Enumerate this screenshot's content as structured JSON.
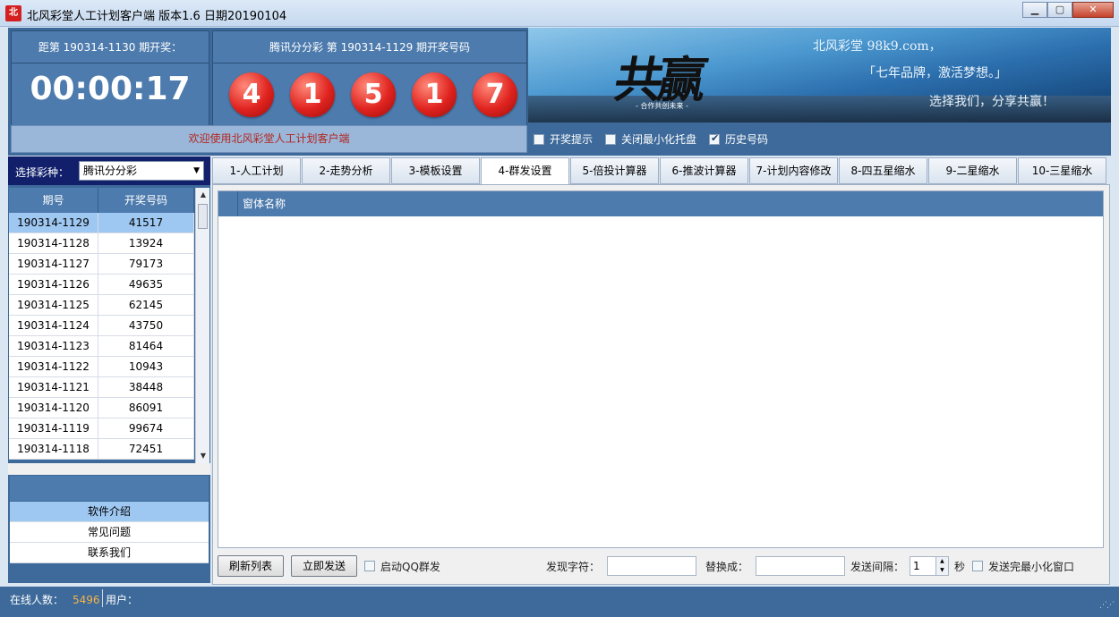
{
  "window": {
    "title": "北风彩堂人工计划客户端     版本1.6   日期20190104",
    "icon_text": "北",
    "minimize": "▁",
    "maximize": "▢",
    "close": "✕"
  },
  "countdown": {
    "label": "距第 190314-1130 期开奖：",
    "time": "00:00:17"
  },
  "draw": {
    "label": "腾讯分分彩 第 190314-1129 期开奖号码",
    "balls": [
      "4",
      "1",
      "5",
      "1",
      "7"
    ],
    "ball_color": "#e0231f"
  },
  "banner": {
    "calligraphy": "共赢",
    "calligraphy_sub": "- 合作共创未来 -",
    "line1": "北风彩堂  98k9.com，",
    "line2": "「七年品牌，激活梦想。」",
    "line3": "选择我们，分享共赢！"
  },
  "welcome": "欢迎使用北风彩堂人工计划客户端",
  "options": [
    {
      "label": "开奖提示",
      "checked": false
    },
    {
      "label": "关闭最小化托盘",
      "checked": false
    },
    {
      "label": "历史号码",
      "checked": true
    }
  ],
  "lottery": {
    "label": "选择彩种：",
    "selected": "腾讯分分彩"
  },
  "history": {
    "headers": [
      "期号",
      "开奖号码"
    ],
    "rows": [
      [
        "190314-1129",
        "41517"
      ],
      [
        "190314-1128",
        "13924"
      ],
      [
        "190314-1127",
        "79173"
      ],
      [
        "190314-1126",
        "49635"
      ],
      [
        "190314-1125",
        "62145"
      ],
      [
        "190314-1124",
        "43750"
      ],
      [
        "190314-1123",
        "81464"
      ],
      [
        "190314-1122",
        "10943"
      ],
      [
        "190314-1121",
        "38448"
      ],
      [
        "190314-1120",
        "86091"
      ],
      [
        "190314-1119",
        "99674"
      ],
      [
        "190314-1118",
        "72451"
      ]
    ]
  },
  "menu": [
    "软件介绍",
    "常见问题",
    "联系我们"
  ],
  "tabs": [
    "1-人工计划",
    "2-走势分析",
    "3-模板设置",
    "4-群发设置",
    "5-倍投计算器",
    "6-推波计算器",
    "7-计划内容修改",
    "8-四五星缩水",
    "9-二星缩水",
    "10-三星缩水"
  ],
  "active_tab": 3,
  "list": {
    "header_name": "窗体名称"
  },
  "bottom": {
    "refresh_button": "刷新列表",
    "send_button": "立即发送",
    "qq_label": "启动QQ群发",
    "find_label": "发现字符：",
    "replace_label": "替换成：",
    "interval_label": "发送间隔：",
    "interval_value": "1",
    "interval_unit": "秒",
    "minimize_label": "发送完最小化窗口"
  },
  "status": {
    "online_label": "在线人数：",
    "online_count": "5496",
    "user_label": "用户："
  },
  "colors": {
    "panel_blue": "#3d6a9a",
    "header_blue": "#4d7bad",
    "selected_row": "#9ec7f2",
    "welcome_text": "#b3261e",
    "online_count": "#f5b34a"
  }
}
